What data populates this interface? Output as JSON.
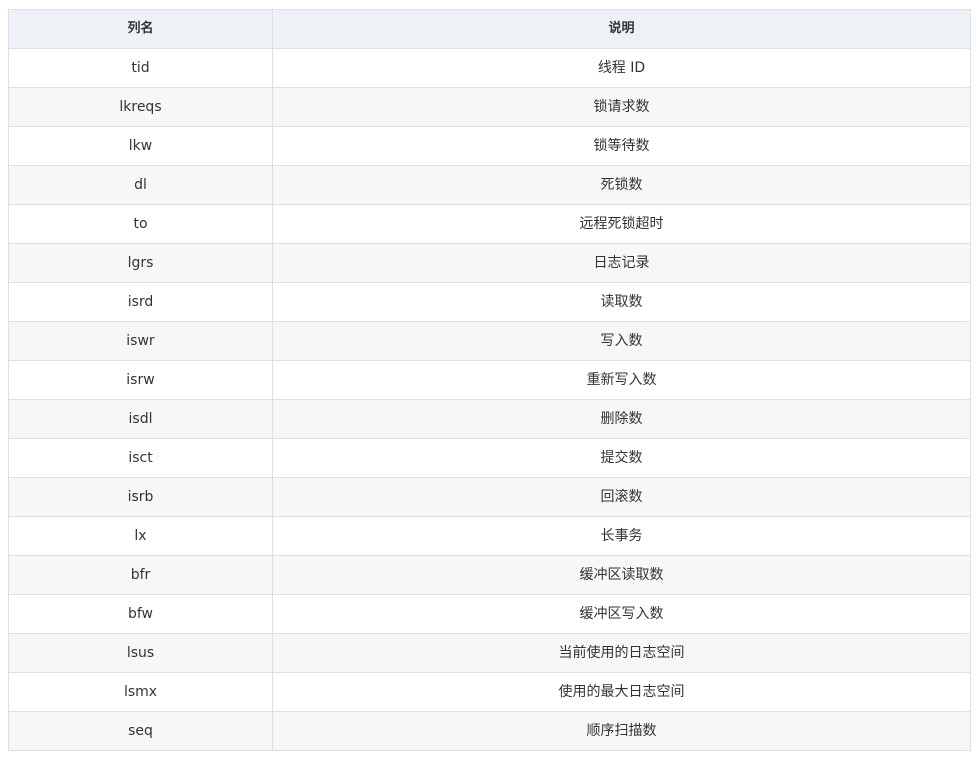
{
  "table": {
    "headers": [
      "列名",
      "说明"
    ],
    "rows": [
      [
        "tid",
        "线程 ID"
      ],
      [
        "lkreqs",
        "锁请求数"
      ],
      [
        "lkw",
        "锁等待数"
      ],
      [
        "dl",
        "死锁数"
      ],
      [
        "to",
        "远程死锁超时"
      ],
      [
        "lgrs",
        "日志记录"
      ],
      [
        "isrd",
        "读取数"
      ],
      [
        "iswr",
        "写入数"
      ],
      [
        "isrw",
        "重新写入数"
      ],
      [
        "isdl",
        "删除数"
      ],
      [
        "isct",
        "提交数"
      ],
      [
        "isrb",
        "回滚数"
      ],
      [
        "lx",
        "长事务"
      ],
      [
        "bfr",
        "缓冲区读取数"
      ],
      [
        "bfw",
        "缓冲区写入数"
      ],
      [
        "lsus",
        "当前使用的日志空间"
      ],
      [
        "lsmx",
        "使用的最大日志空间"
      ],
      [
        "seq",
        "顺序扫描数"
      ]
    ]
  }
}
